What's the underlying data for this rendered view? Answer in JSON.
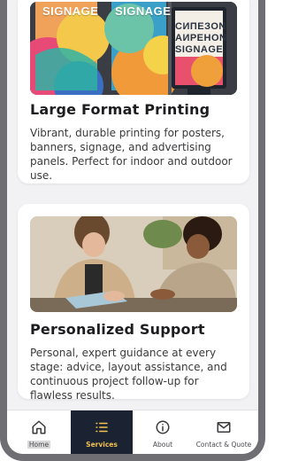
{
  "cards": [
    {
      "title": "Large Format Printing",
      "description": "Vibrant, durable printing for posters, banners, signage, and advertising panels. Perfect for indoor and outdoor use.",
      "image_text": {
        "panel1": "SIGNAGE",
        "panel2": "SIGNAGE",
        "panel3": "CИПЕЗОN AИPEHON SIGNAGE"
      }
    },
    {
      "title": "Personalized Support",
      "description": "Personal, expert guidance at every stage: advice, layout assistance, and continuous project follow-up for flawless results."
    }
  ],
  "nav": {
    "items": [
      {
        "label": "Home",
        "icon": "home-icon"
      },
      {
        "label": "Services",
        "icon": "list-icon",
        "active": true
      },
      {
        "label": "About",
        "icon": "info-icon"
      },
      {
        "label": "Contact & Quote",
        "icon": "mail-icon"
      }
    ]
  },
  "colors": {
    "nav_active_bg": "#1b2333",
    "nav_active_text": "#f2c14e",
    "page_bg": "#f2f2f4",
    "frame": "#6e6e73"
  }
}
